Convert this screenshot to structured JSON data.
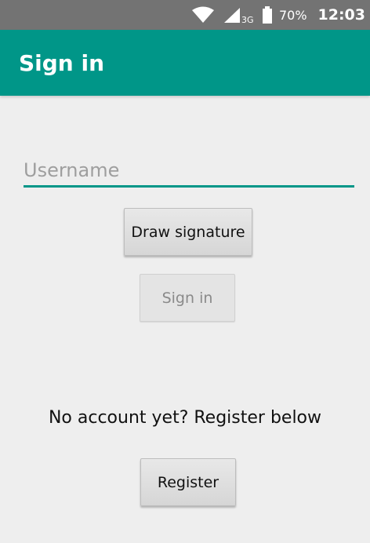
{
  "status_bar": {
    "network_type": "3G",
    "battery_percent": "70%",
    "time": "12:03",
    "icons": [
      "wifi-icon",
      "signal-icon",
      "battery-icon"
    ]
  },
  "app_bar": {
    "title": "Sign in",
    "color": "#009688"
  },
  "form": {
    "username_placeholder": "Username",
    "username_value": "",
    "draw_signature_label": "Draw signature",
    "sign_in_label": "Sign in",
    "no_account_text": "No account yet? Register below",
    "register_label": "Register"
  }
}
